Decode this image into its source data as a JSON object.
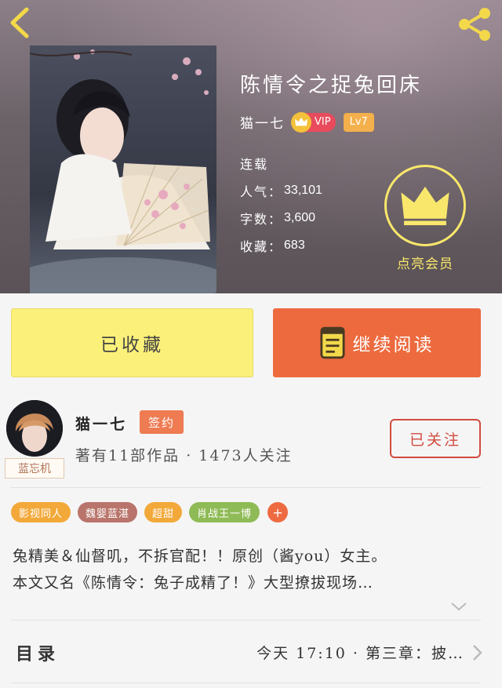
{
  "header": {
    "back_icon": "chevron-left-icon",
    "share_icon": "share-icon"
  },
  "book": {
    "title": "陈情令之捉兔回床",
    "author": "猫一七",
    "vip_label": "VIP",
    "level": "Lv7",
    "status": "连载",
    "popularity_label": "人气：",
    "popularity": "33,101",
    "words_label": "字数：",
    "words": "3,600",
    "favorites_label": "收藏：",
    "favorites": "683",
    "member_label": "点亮会员"
  },
  "actions": {
    "saved_label": "已收藏",
    "read_label": "继续阅读"
  },
  "author_card": {
    "name": "猫一七",
    "sign_label": "签约",
    "meta": "著有11部作品 · 1473人关注",
    "follow_label": "已关注",
    "avatar_tag": "蓝忘机"
  },
  "tags": [
    {
      "label": "影视同人",
      "color": "#f2a93a"
    },
    {
      "label": "魏婴蓝湛",
      "color": "#b9756b"
    },
    {
      "label": "超甜",
      "color": "#f2a93a"
    },
    {
      "label": "肖战王一博",
      "color": "#8fbb56"
    }
  ],
  "tag_add": "+",
  "description": {
    "line1": "兔精美＆仙督叽，不拆官配！！原创（酱you）女主。",
    "line2": "本文又名《陈情令：兔子成精了！》大型撩拔现场…"
  },
  "toc": {
    "title": "目录",
    "latest": "今天 17:10 · 第三章：披…"
  },
  "colors": {
    "accent_orange": "#ec6a3e",
    "saved_yellow": "#fbf17a",
    "vip_gold": "#f8e76b"
  }
}
